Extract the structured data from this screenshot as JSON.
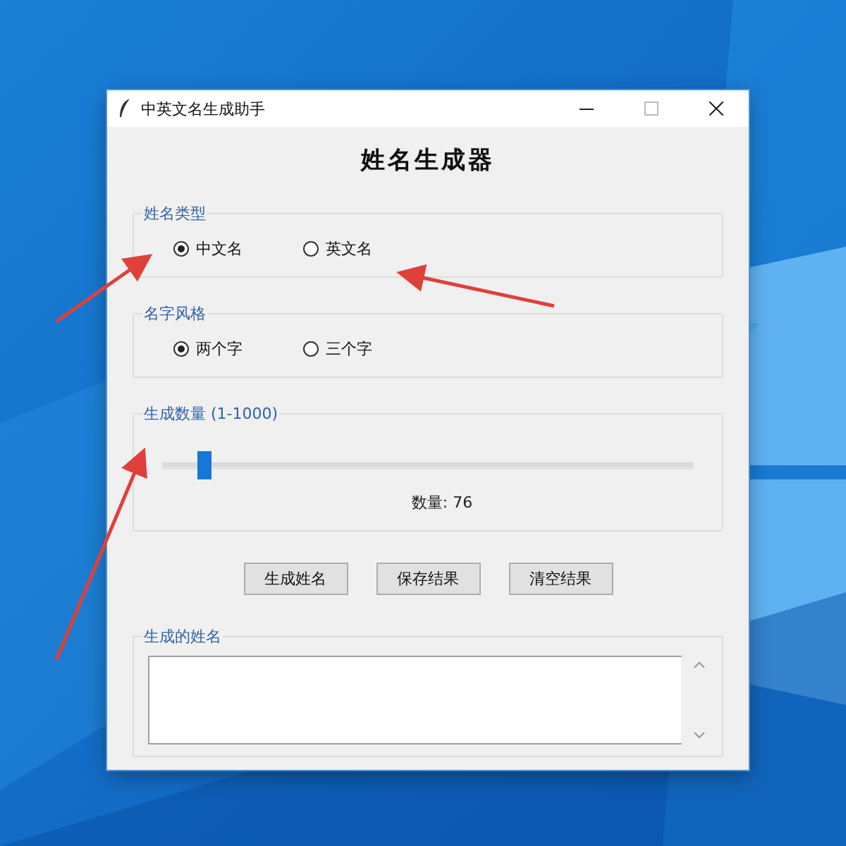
{
  "window": {
    "title": "中英文名生成助手"
  },
  "heading": "姓名生成器",
  "groups": [
    {
      "kind": "radio",
      "title": "姓名类型",
      "options": [
        {
          "label": "中文名",
          "selected": true
        },
        {
          "label": "英文名",
          "selected": false
        }
      ]
    },
    {
      "kind": "radio",
      "title": "名字风格",
      "options": [
        {
          "label": "两个字",
          "selected": true
        },
        {
          "label": "三个字",
          "selected": false
        }
      ]
    },
    {
      "kind": "slider",
      "title": "生成数量 (1-1000)",
      "level": 0.08,
      "reading": "数量: 76"
    }
  ],
  "buttons": [
    "生成姓名",
    "保存结果",
    "清空结果"
  ],
  "output": {
    "title": "生成的姓名"
  }
}
